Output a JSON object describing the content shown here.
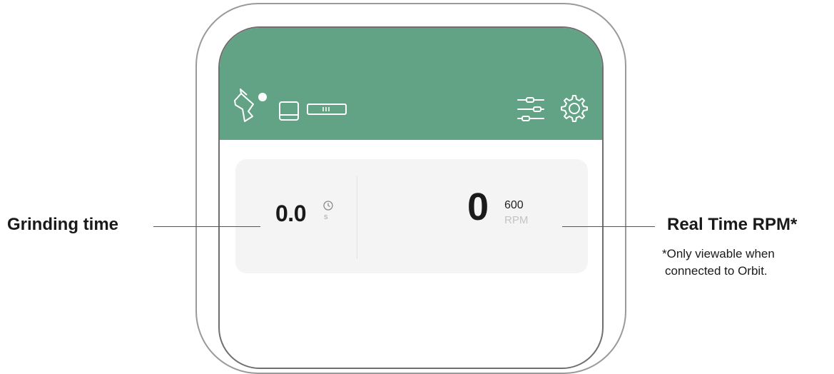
{
  "app": {
    "header": {
      "icons_left": [
        "grinder-icon",
        "hopper-icon",
        "battery-icon"
      ],
      "icons_right": [
        "sliders-icon",
        "gear-icon"
      ]
    },
    "card": {
      "grinding_time_value": "0.0",
      "grinding_time_unit": "s",
      "rpm_value": "0",
      "rpm_target": "600",
      "rpm_unit": "RPM"
    },
    "colors": {
      "header_green": "#62a386",
      "card_bg": "#f4f4f4"
    }
  },
  "annotations": {
    "left_label": "Grinding time",
    "right_label": "Real Time RPM*",
    "right_note_line1": "*Only viewable when",
    "right_note_line2": "connected to Orbit."
  }
}
